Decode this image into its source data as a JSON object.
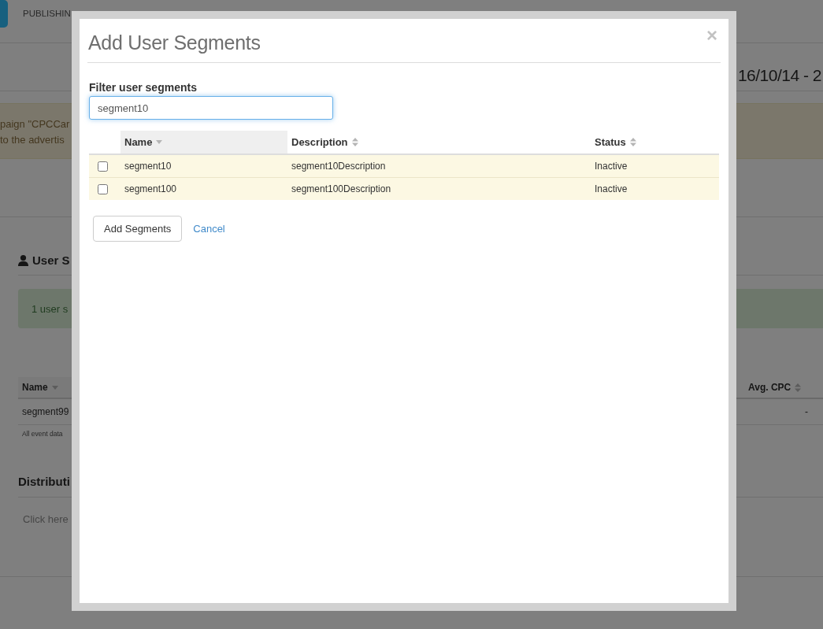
{
  "background": {
    "nav": {
      "label": "PUBLISHIN"
    },
    "date_range": "16/10/14 - 2",
    "alert_lines": [
      "paign \"CPCCar",
      "to the advertis"
    ],
    "user_segments": {
      "heading": "User S",
      "notice": "1 user s",
      "table": {
        "columns": [
          {
            "label": "Name",
            "sorted": true
          },
          {
            "label": "Avg. CPC",
            "sorted": false
          }
        ],
        "rows": [
          {
            "name": "segment99",
            "avg_cpc": "-"
          }
        ]
      },
      "footnote": "All event data"
    },
    "distribution": {
      "heading": "Distributi",
      "hint": "Click here"
    }
  },
  "dialog": {
    "title": "Add User Segments",
    "close": "×",
    "filter": {
      "label": "Filter user segments",
      "value": "segment10",
      "focused": true
    },
    "table": {
      "columns": [
        {
          "label": "Name",
          "sorted": true
        },
        {
          "label": "Description",
          "sorted": false
        },
        {
          "label": "Status",
          "sorted": false
        }
      ],
      "rows": [
        {
          "checked": false,
          "name": "segment10",
          "description": "segment10Description",
          "status": "Inactive"
        },
        {
          "checked": false,
          "name": "segment100",
          "description": "segment100Description",
          "status": "Inactive"
        }
      ]
    },
    "buttons": [
      {
        "label": "Add Segments",
        "kind": "default"
      },
      {
        "label": "Cancel",
        "kind": "link"
      }
    ]
  }
}
